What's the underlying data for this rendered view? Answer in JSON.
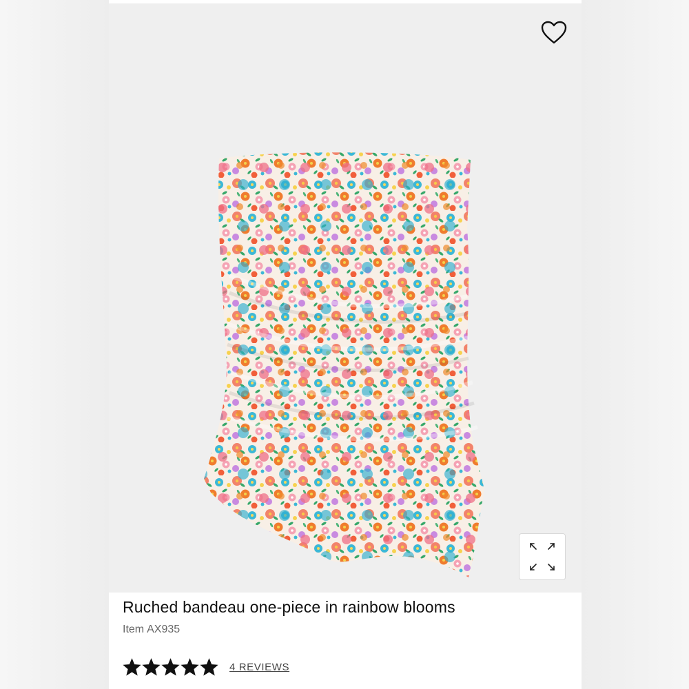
{
  "product": {
    "title": "Ruched bandeau one-piece in rainbow blooms",
    "item_label": "Item",
    "item_code": "AX935",
    "rating": 5,
    "rating_max": 5,
    "reviews_link": "4 REVIEWS"
  },
  "icons": {
    "favorite": "heart-icon",
    "expand": "expand-icon",
    "star": "star-icon"
  },
  "colors": {
    "image_bg": "#efefef",
    "text": "#111111",
    "muted": "#666666"
  }
}
